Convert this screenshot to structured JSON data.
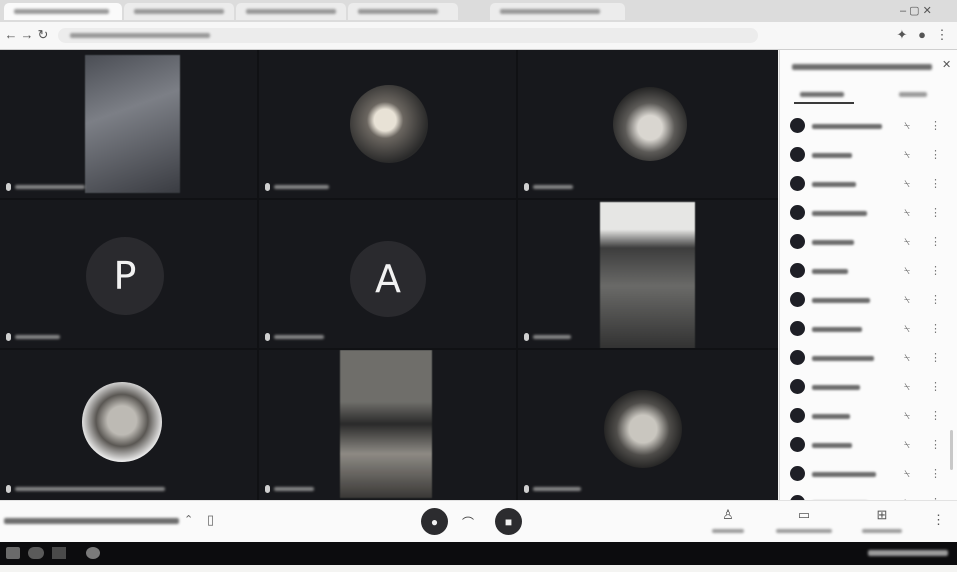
{
  "grid": {
    "tile_p": {
      "letter": "P"
    },
    "tile_a": {
      "letter": "A"
    }
  },
  "controls": {
    "mic_button": {
      "icon": "mic-off-icon"
    },
    "end_call_button": {
      "icon": "phone-hangup-icon"
    },
    "camera_button": {
      "icon": "camera-off-icon"
    },
    "right_icons": [
      "people-icon",
      "chat-icon",
      "activities-icon",
      "more-vertical-icon"
    ]
  },
  "panel": {
    "participants": [
      {
        "avatar": "person-avatar-icon"
      },
      {
        "avatar": "person-avatar-icon"
      },
      {
        "avatar": "person-avatar-icon"
      },
      {
        "avatar": "person-avatar-icon"
      },
      {
        "avatar": "person-avatar-icon"
      },
      {
        "avatar": "person-avatar-icon"
      },
      {
        "avatar": "person-avatar-icon"
      },
      {
        "avatar": "person-avatar-icon"
      },
      {
        "avatar": "person-avatar-icon"
      },
      {
        "avatar": "person-avatar-icon"
      },
      {
        "avatar": "person-avatar-icon"
      },
      {
        "avatar": "person-avatar-icon"
      },
      {
        "avatar": "person-avatar-icon"
      },
      {
        "avatar": "person-avatar-icon"
      }
    ]
  },
  "colors": {
    "grid_background": "#101114",
    "tile_background": "#17181c",
    "panel_background": "#fbfbfb",
    "control_button": "#2c2c2f",
    "taskbar": "#0c0c0e"
  }
}
